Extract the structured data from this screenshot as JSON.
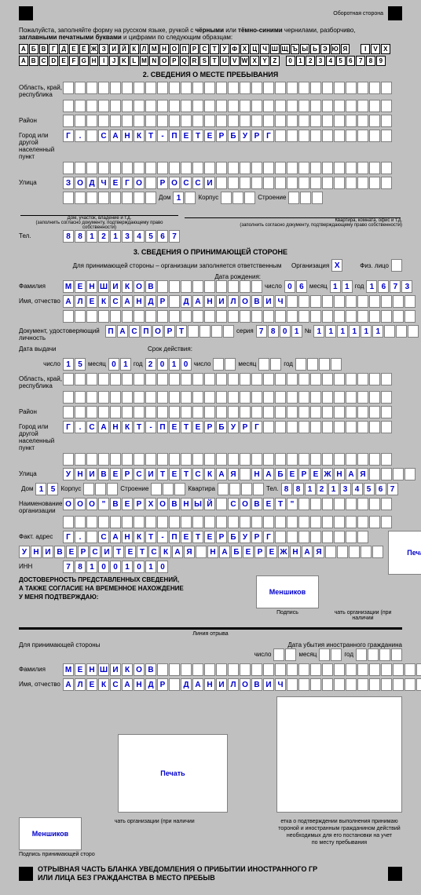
{
  "top_right_label": "Оборотная сторона",
  "instructions_line1": "Пожалуйста, заполняйте форму на русском языке, ручкой с ",
  "instructions_bold1": "чёрными",
  "instructions_mid1": " или ",
  "instructions_bold2": "тёмно-синими",
  "instructions_mid2": " чернилами, разборчиво,",
  "instructions_line2a": "заглавными печатными буквами",
  "instructions_line2b": " и цифрами по следующим образцам:",
  "alphabet_ru": [
    "А",
    "Б",
    "В",
    "Г",
    "Д",
    "Е",
    "Ё",
    "Ж",
    "З",
    "И",
    "Й",
    "К",
    "Л",
    "М",
    "Н",
    "О",
    "П",
    "Р",
    "С",
    "Т",
    "У",
    "Ф",
    "Х",
    "Ц",
    "Ч",
    "Ш",
    "Щ",
    "Ъ",
    "Ы",
    "Ь",
    "Э",
    "Ю",
    "Я"
  ],
  "alphabet_roman": [
    "I",
    "V",
    "X"
  ],
  "alphabet_en": [
    "A",
    "B",
    "C",
    "D",
    "E",
    "F",
    "G",
    "H",
    "I",
    "J",
    "K",
    "L",
    "M",
    "N",
    "O",
    "P",
    "Q",
    "R",
    "S",
    "T",
    "U",
    "V",
    "W",
    "X",
    "Y",
    "Z"
  ],
  "digits": [
    "0",
    "1",
    "2",
    "3",
    "4",
    "5",
    "6",
    "7",
    "8",
    "9"
  ],
  "section2_title": "2. СВЕДЕНИЯ О МЕСТЕ ПРЕБЫВАНИЯ",
  "section3_title": "3. СВЕДЕНИЯ О ПРИНИМАЮЩЕЙ СТОРОНЕ",
  "labels": {
    "oblast": "Область, край, республика",
    "raion": "Район",
    "city": "Город или другой населенный пункт",
    "street": "Улица",
    "house": "Дом",
    "corpus": "Корпус",
    "building": "Строение",
    "apartment": "Квартира, комната, офис и т.д.",
    "house_addr": "Дом, участок, владение и т.д.",
    "doc_hint": "(заполнить согласно документу, подтверждающему право собственности)",
    "tel": "Тел.",
    "host_note": "Для принимающей стороны – организации заполняется ответственным",
    "organization": "Организация",
    "individual": "Физ. лицо",
    "birth_date": "Дата рождения:",
    "surname": "Фамилия",
    "name_patronymic": "Имя, отчество",
    "doc_identity": "Документ, удостоверяющий личность",
    "series": "серия",
    "number": "№",
    "date_issue": "Дата выдачи",
    "validity": "Срок действия:",
    "number_day": "число",
    "month": "месяц",
    "year": "год",
    "org_name": "Наименование организации",
    "fact_addr": "Факт. адрес",
    "inn": "ИНН",
    "kvartira": "Квартира",
    "stamp": "Печать",
    "signature": "Подпись",
    "org_stamp_hint": "чать организации (при наличии",
    "confirm1": "ДОСТОВЕРНОСТЬ ПРЕДСТАВЛЕННЫХ СВЕДЕНИЙ,",
    "confirm2": "А ТАКЖЕ СОГЛАСИЕ НА ВРЕМЕННОЕ НАХОЖДЕНИЕ",
    "confirm3": "У МЕНЯ ПОДТВЕРЖДАЮ:",
    "cut_line": "Линия  отрыва",
    "for_host": "Для принимающей стороны",
    "departure": "Дата убытия иностранного гражданина",
    "sig_host_hint": "Подпись принимающей сторо",
    "mark_hint1": "етка о подтверждении выполнения принимаю",
    "mark_hint2": "тороной и иностранным гражданином действий",
    "mark_hint3": "необходимых для его постановки на учет",
    "mark_hint4": "по месту пребывания",
    "footer1": "ОТРЫВНАЯ ЧАСТЬ БЛАНКА УВЕДОМЛЕНИЯ О ПРИБЫТИИ ИНОСТРАННОГО ГР",
    "footer2": "ИЛИ ЛИЦА БЕЗ ГРАЖДАНСТВА В МЕСТО ПРЕБЫВ"
  },
  "values": {
    "s2_oblast": [
      "",
      "",
      "",
      "",
      "",
      "",
      "",
      "",
      "",
      "",
      "",
      "",
      "",
      "",
      "",
      "",
      "",
      "",
      "",
      "",
      "",
      "",
      "",
      "",
      "",
      "",
      "",
      ""
    ],
    "s2_oblast2": [
      "",
      "",
      "",
      "",
      "",
      "",
      "",
      "",
      "",
      "",
      "",
      "",
      "",
      "",
      "",
      "",
      "",
      "",
      "",
      "",
      "",
      "",
      "",
      "",
      "",
      "",
      "",
      ""
    ],
    "s2_raion": [
      "",
      "",
      "",
      "",
      "",
      "",
      "",
      "",
      "",
      "",
      "",
      "",
      "",
      "",
      "",
      "",
      "",
      "",
      "",
      "",
      "",
      "",
      "",
      "",
      "",
      "",
      "",
      ""
    ],
    "s2_city": [
      "Г",
      ".",
      "",
      "С",
      "А",
      "Н",
      "К",
      "Т",
      "-",
      "П",
      "Е",
      "Т",
      "Е",
      "Р",
      "Б",
      "У",
      "Р",
      "Г",
      "",
      "",
      "",
      "",
      "",
      "",
      "",
      "",
      "",
      ""
    ],
    "s2_city2": [
      "",
      "",
      "",
      "",
      "",
      "",
      "",
      "",
      "",
      "",
      "",
      "",
      "",
      "",
      "",
      "",
      "",
      "",
      "",
      "",
      "",
      "",
      "",
      "",
      "",
      "",
      "",
      ""
    ],
    "s2_street": [
      "З",
      "О",
      "Д",
      "Ч",
      "Е",
      "Г",
      "О",
      "",
      "Р",
      "О",
      "С",
      "С",
      "И",
      "",
      "",
      "",
      "",
      "",
      "",
      "",
      "",
      "",
      "",
      "",
      "",
      "",
      "",
      ""
    ],
    "s2_street2": [
      "",
      "",
      "",
      "",
      "",
      "",
      "",
      ""
    ],
    "s2_house": [
      "1",
      ""
    ],
    "s2_corpus": [
      "",
      "",
      ""
    ],
    "s2_building": [
      "",
      "",
      ""
    ],
    "s2_tel": [
      "8",
      "8",
      "1",
      "2",
      "1",
      "3",
      "4",
      "5",
      "6",
      "7"
    ],
    "s3_org_check": "X",
    "s3_ind_check": "",
    "s3_birth_day": [
      "0",
      "6"
    ],
    "s3_birth_month": [
      "1",
      "1"
    ],
    "s3_birth_year": [
      "1",
      "6",
      "7",
      "3"
    ],
    "s3_surname": [
      "М",
      "Е",
      "Н",
      "Ш",
      "И",
      "К",
      "О",
      "В",
      "",
      "",
      "",
      "",
      "",
      "",
      "",
      "",
      ""
    ],
    "s3_name": [
      "А",
      "Л",
      "Е",
      "К",
      "С",
      "А",
      "Н",
      "Д",
      "Р",
      "",
      "Д",
      "А",
      "Н",
      "И",
      "Л",
      "О",
      "В",
      "И",
      "Ч",
      "",
      "",
      "",
      "",
      "",
      "",
      "",
      "",
      "",
      "",
      ""
    ],
    "s3_name2": [
      "",
      "",
      "",
      "",
      "",
      "",
      "",
      "",
      "",
      "",
      "",
      "",
      "",
      "",
      "",
      "",
      "",
      "",
      "",
      "",
      "",
      "",
      "",
      "",
      "",
      "",
      "",
      "",
      "",
      ""
    ],
    "s3_doc_type": [
      "П",
      "А",
      "С",
      "П",
      "О",
      "Р",
      "Т",
      "",
      "",
      "",
      ""
    ],
    "s3_doc_series": [
      "7",
      "8",
      "0",
      "1"
    ],
    "s3_doc_num": [
      "1",
      "1",
      "1",
      "1",
      "1",
      "1",
      "",
      "",
      ""
    ],
    "s3_issue_day": [
      "1",
      "5"
    ],
    "s3_issue_month": [
      "0",
      "1"
    ],
    "s3_issue_year": [
      "2",
      "0",
      "1",
      "0"
    ],
    "s3_valid_day": [
      "",
      ""
    ],
    "s3_valid_month": [
      "",
      ""
    ],
    "s3_valid_year": [
      "",
      "",
      "",
      ""
    ],
    "s3_oblast": [
      "",
      "",
      "",
      "",
      "",
      "",
      "",
      "",
      "",
      "",
      "",
      "",
      "",
      "",
      "",
      "",
      "",
      "",
      "",
      "",
      "",
      "",
      "",
      "",
      "",
      "",
      "",
      ""
    ],
    "s3_oblast2": [
      "",
      "",
      "",
      "",
      "",
      "",
      "",
      "",
      "",
      "",
      "",
      "",
      "",
      "",
      "",
      "",
      "",
      "",
      "",
      "",
      "",
      "",
      "",
      "",
      "",
      "",
      "",
      ""
    ],
    "s3_raion": [
      "",
      "",
      "",
      "",
      "",
      "",
      "",
      "",
      "",
      "",
      "",
      "",
      "",
      "",
      "",
      "",
      "",
      "",
      "",
      "",
      "",
      "",
      "",
      "",
      "",
      "",
      "",
      ""
    ],
    "s3_city": [
      "Г",
      ".",
      "С",
      "А",
      "Н",
      "К",
      "Т",
      "-",
      "П",
      "Е",
      "Т",
      "Е",
      "Р",
      "Б",
      "У",
      "Р",
      "Г",
      "",
      "",
      "",
      "",
      "",
      "",
      "",
      "",
      "",
      "",
      ""
    ],
    "s3_city2": [
      "",
      "",
      "",
      "",
      "",
      "",
      "",
      "",
      "",
      "",
      "",
      "",
      "",
      "",
      "",
      "",
      "",
      "",
      "",
      "",
      "",
      "",
      "",
      "",
      "",
      "",
      "",
      ""
    ],
    "s3_street": [
      "У",
      "Н",
      "И",
      "В",
      "Е",
      "Р",
      "С",
      "И",
      "Т",
      "Е",
      "Т",
      "С",
      "К",
      "А",
      "Я",
      "",
      "Н",
      "А",
      "Б",
      "Е",
      "Р",
      "Е",
      "Ж",
      "Н",
      "А",
      "Я",
      "",
      "",
      "",
      ""
    ],
    "s3_house": [
      "1",
      "5"
    ],
    "s3_corpus": [
      "",
      "",
      ""
    ],
    "s3_building": [
      "",
      "",
      ""
    ],
    "s3_kvartira": [
      "",
      "",
      "",
      ""
    ],
    "s3_tel": [
      "8",
      "8",
      "1",
      "2",
      "1",
      "3",
      "4",
      "5",
      "6",
      "7"
    ],
    "s3_org_name1": [
      "О",
      "О",
      "О",
      "\"",
      "В",
      "Е",
      "Р",
      "Х",
      "О",
      "В",
      "Н",
      "Ы",
      "Й",
      "",
      "С",
      "О",
      "В",
      "Е",
      "Т",
      "\"",
      "",
      "",
      "",
      "",
      "",
      "",
      "",
      ""
    ],
    "s3_org_name2": [
      "",
      "",
      "",
      "",
      "",
      "",
      "",
      "",
      "",
      "",
      "",
      "",
      "",
      "",
      "",
      "",
      "",
      "",
      "",
      "",
      "",
      "",
      "",
      "",
      "",
      "",
      "",
      ""
    ],
    "s3_fact_addr1": [
      "Г",
      ".",
      "",
      "С",
      "А",
      "Н",
      "К",
      "Т",
      "-",
      "П",
      "Е",
      "Т",
      "Е",
      "Р",
      "Б",
      "У",
      "Р",
      "Г",
      "",
      "",
      "",
      "",
      "",
      "",
      "",
      ""
    ],
    "s3_fact_addr2": [
      "У",
      "Н",
      "И",
      "В",
      "Е",
      "Р",
      "С",
      "И",
      "Т",
      "Е",
      "Т",
      "С",
      "К",
      "А",
      "Я",
      "",
      "Н",
      "А",
      "Б",
      "Е",
      "Р",
      "Е",
      "Ж",
      "Н",
      "А",
      "Я",
      "",
      "",
      "",
      "",
      ""
    ],
    "s3_inn": [
      "7",
      "8",
      "1",
      "0",
      "0",
      "1",
      "0",
      "1",
      "0"
    ],
    "s3_sig_name": "Меншиков",
    "bot_surname": [
      "М",
      "Е",
      "Н",
      "Ш",
      "И",
      "К",
      "О",
      "В",
      "",
      "",
      "",
      "",
      "",
      "",
      "",
      "",
      "",
      "",
      "",
      "",
      "",
      "",
      "",
      "",
      "",
      "",
      "",
      "",
      "",
      "",
      "",
      ""
    ],
    "bot_name": [
      "А",
      "Л",
      "Е",
      "К",
      "С",
      "А",
      "Н",
      "Д",
      "Р",
      "",
      "Д",
      "А",
      "Н",
      "И",
      "Л",
      "О",
      "В",
      "И",
      "Ч",
      "",
      "",
      "",
      "",
      "",
      "",
      "",
      "",
      "",
      "",
      "",
      "",
      ""
    ],
    "bot_dep_day": [
      "",
      ""
    ],
    "bot_dep_month": [
      "",
      ""
    ],
    "bot_dep_year": [
      "",
      "",
      "",
      ""
    ],
    "bot_sig_name": "Меншиков"
  }
}
